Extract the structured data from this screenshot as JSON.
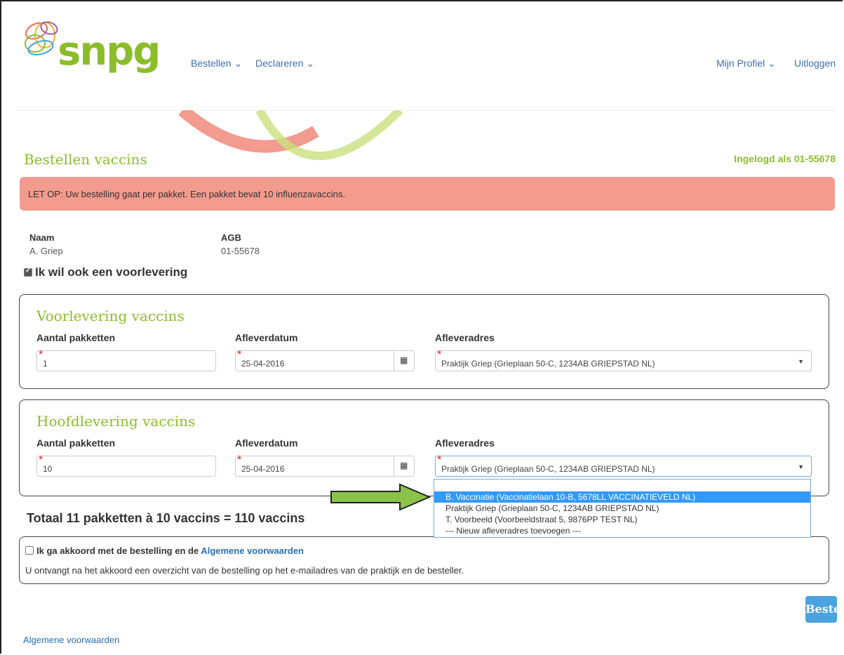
{
  "header": {
    "logo_text": "snpg",
    "nav_left": [
      {
        "label": "Bestellen ⌄"
      },
      {
        "label": "Declareren ⌄"
      }
    ],
    "nav_right": [
      {
        "label": "Mijn Profiel ⌄"
      },
      {
        "label": "Uitloggen"
      }
    ]
  },
  "page": {
    "title": "Bestellen vaccins",
    "logged_in": "Ingelogd als 01-55678",
    "alert": "LET OP: Uw bestelling gaat per pakket. Een pakket bevat 10 influenzavaccins."
  },
  "info": {
    "name_label": "Naam",
    "name_value": "A. Griep",
    "agb_label": "AGB",
    "agb_value": "01-55678",
    "preorder_check": "Ik wil ook een voorlevering"
  },
  "voorlevering": {
    "title": "Voorlevering vaccins",
    "qty_label": "Aantal pakketten",
    "qty_value": "1",
    "date_label": "Afleverdatum",
    "date_value": "25-04-2016",
    "addr_label": "Afleveradres",
    "addr_value": "Praktijk Griep (Grieplaan 50-C, 1234AB GRIEPSTAD NL)"
  },
  "hoofdlevering": {
    "title": "Hoofdlevering vaccins",
    "qty_label": "Aantal pakketten",
    "qty_value": "10",
    "date_label": "Afleverdatum",
    "date_value": "25-04-2016",
    "addr_label": "Afleveradres",
    "addr_value": "Praktijk Griep (Grieplaan 50-C, 1234AB GRIEPSTAD NL)"
  },
  "dropdown": {
    "options": [
      "B. Vaccinatie (Vaccinatielaan 10-B, 5678LL VACCINATIEVELD NL)",
      "Praktijk Griep (Grieplaan 50-C, 1234AB GRIEPSTAD NL)",
      "T. Voorbeeld (Voorbeeldstraat 5, 9876PP TEST NL)",
      "--- Nieuw afleveradres toevoegen ---"
    ]
  },
  "total": "Totaal 11 pakketten à 10 vaccins = 110 vaccins",
  "agree": {
    "text": "Ik ga akkoord met de bestelling en de",
    "link": "Algemene voorwaarden",
    "note": "U ontvangt na het akkoord een overzicht van de bestelling op het e-mailadres van de praktijk en de besteller."
  },
  "order_button": "Bestel",
  "footer_link": "Algemene voorwaarden",
  "colors": {
    "brand_green": "#8bbd2b",
    "alert_bg": "#f39b8e",
    "link_blue": "#2a6fb5",
    "button_blue": "#4aa3df",
    "selection_blue": "#3399ff"
  }
}
